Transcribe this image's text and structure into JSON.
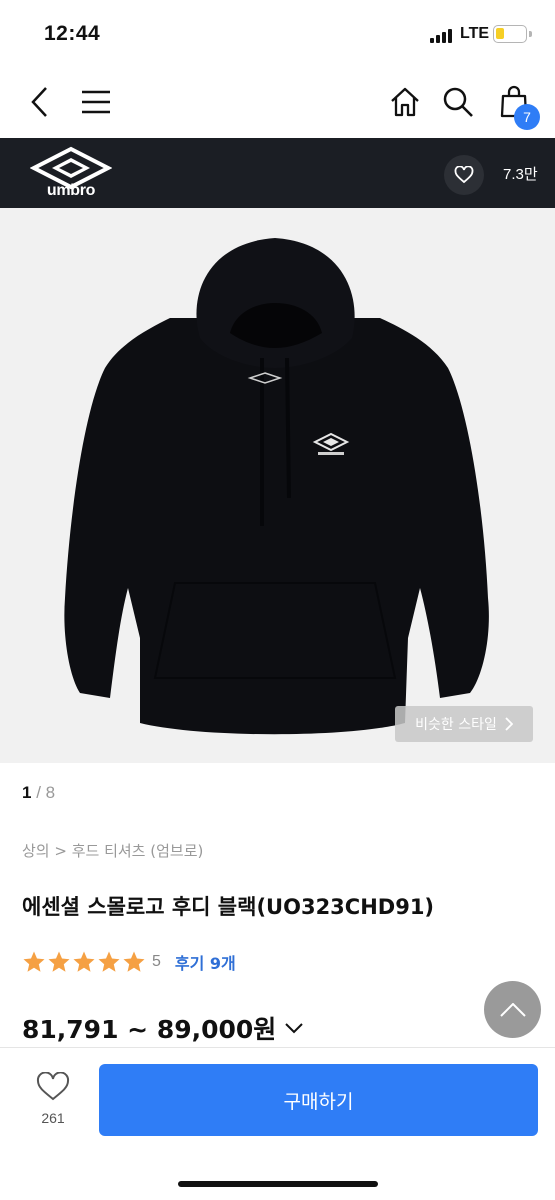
{
  "status_bar": {
    "time": "12:44",
    "network": "LTE",
    "battery_level": 0.3
  },
  "nav": {
    "cart_count": "7"
  },
  "brand": {
    "name": "umbro",
    "favorite_count": "7.3만"
  },
  "gallery": {
    "current": "1",
    "separator": " / ",
    "total": "8",
    "similar_style_label": "비슷한 스타일"
  },
  "product": {
    "breadcrumb": "상의 > 후드 티셔츠 (엄브로)",
    "title": "에센셜 스몰로고 후디 블랙(UO323CHD91)",
    "rating_value": "5",
    "star_count": 5,
    "review_label": "후기 9개",
    "price": "81,791 ~ 89,000원"
  },
  "bottom_bar": {
    "like_count": "261",
    "buy_label": "구매하기"
  },
  "colors": {
    "accent": "#2f7df6",
    "brand_bar": "#1b1e24",
    "star": "#f5a043",
    "review_link": "#2f6fd6"
  }
}
